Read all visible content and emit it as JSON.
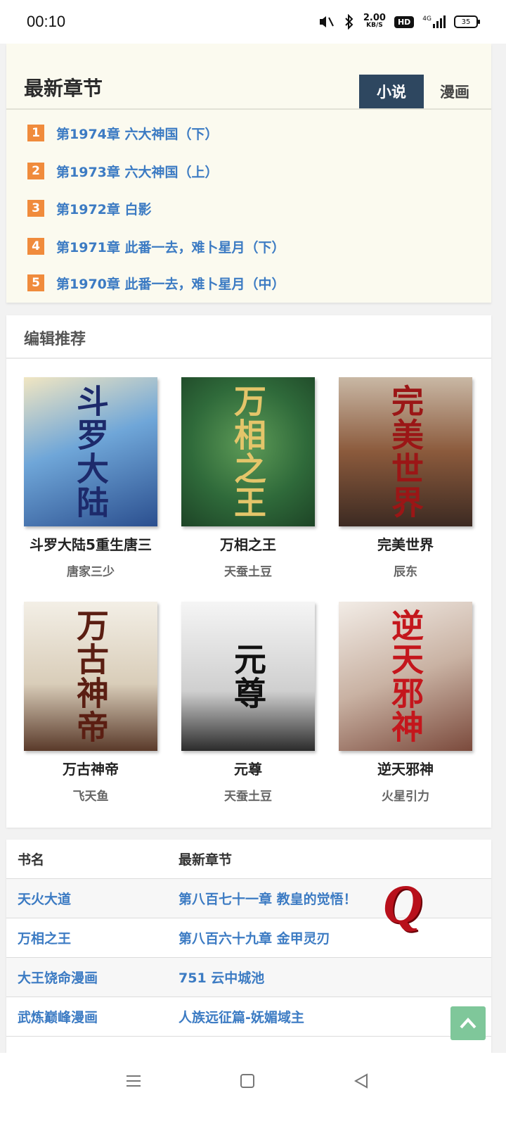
{
  "status": {
    "time": "00:10",
    "speed_value": "2.00",
    "speed_unit": "KB/S",
    "hd": "HD",
    "network": "4G",
    "battery": "35"
  },
  "latest": {
    "title": "最新章节",
    "tabs": {
      "novel": "小说",
      "comic": "漫画"
    },
    "chapters": [
      {
        "num": "1",
        "title": "第1974章 六大神国（下）"
      },
      {
        "num": "2",
        "title": "第1973章 六大神国（上）"
      },
      {
        "num": "3",
        "title": "第1972章 白影"
      },
      {
        "num": "4",
        "title": "第1971章 此番一去，难卜星月（下）"
      },
      {
        "num": "5",
        "title": "第1970章 此番一去，难卜星月（中）"
      }
    ]
  },
  "recommend": {
    "title": "编辑推荐",
    "books": [
      {
        "name": "斗罗大陆5重生唐三",
        "author": "唐家三少",
        "cover_text": "斗罗大陆",
        "cover_color": "#3a73b8"
      },
      {
        "name": "万相之王",
        "author": "天蚕土豆",
        "cover_text": "万相之王",
        "cover_color": "#2f6a3a"
      },
      {
        "name": "完美世界",
        "author": "辰东",
        "cover_text": "完美世界",
        "cover_color": "#7a3b2a"
      },
      {
        "name": "万古神帝",
        "author": "飞天鱼",
        "cover_text": "万古神帝",
        "cover_color": "#e8e2d6"
      },
      {
        "name": "元尊",
        "author": "天蚕土豆",
        "cover_text": "元尊",
        "cover_color": "#d8d8d8"
      },
      {
        "name": "逆天邪神",
        "author": "火星引力",
        "cover_text": "逆天邪神",
        "cover_color": "#d9d2cc"
      }
    ]
  },
  "table": {
    "headers": {
      "name": "书名",
      "latest": "最新章节"
    },
    "rows": [
      {
        "name": "天火大道",
        "latest": "第八百七十一章 教皇的觉悟！"
      },
      {
        "name": "万相之王",
        "latest": "第八百六十九章 金甲灵刃"
      },
      {
        "name": "大王饶命漫画",
        "latest": "751 云中城池"
      },
      {
        "name": "武炼巅峰漫画",
        "latest": "人族远征篇-妩媚域主"
      }
    ]
  },
  "overlay": {
    "logo": "Q"
  },
  "colors": {
    "tab_active": "#2e4760",
    "rank_badge": "#f08b3c",
    "link": "#3c7bc3",
    "back_to_top": "#7fc79a"
  }
}
